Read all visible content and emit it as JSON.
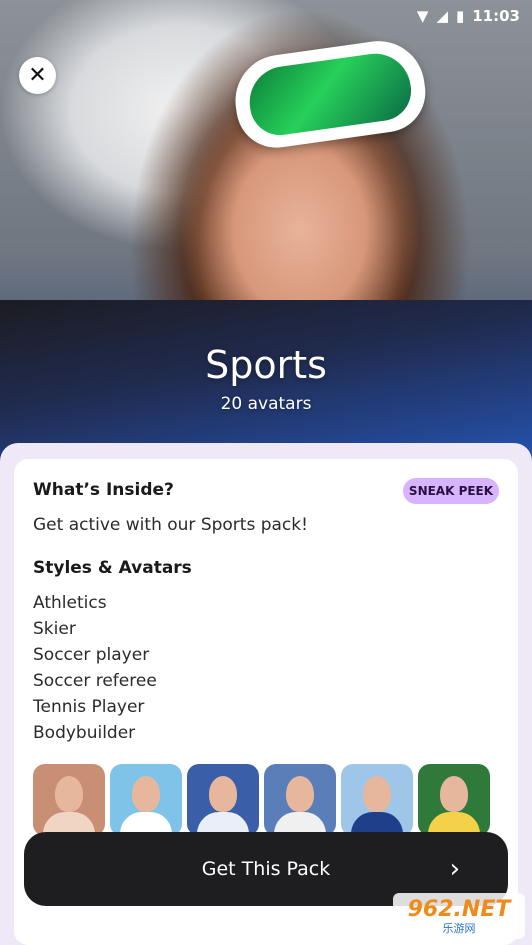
{
  "status_bar": {
    "wifi_icon": "wifi-icon",
    "signal_icon": "signal-icon",
    "battery_icon": "battery-charging-icon",
    "time": "11:03"
  },
  "hero": {
    "close_icon": "close-icon",
    "title": "Sports",
    "subtitle": "20 avatars"
  },
  "info": {
    "heading": "What’s Inside?",
    "badge": "SNEAK PEEK",
    "description": "Get active with our Sports pack!",
    "styles_heading": "Styles & Avatars",
    "styles": [
      "Athletics",
      "Skier",
      "Soccer player",
      "Soccer referee",
      "Tennis Player",
      "Bodybuilder"
    ]
  },
  "thumbnails": [
    {
      "name": "athletics-avatar",
      "bg": "#c98f74",
      "body": "#f0d4c4"
    },
    {
      "name": "tennis-avatar",
      "bg": "#7fc4e8",
      "body": "#ffffff"
    },
    {
      "name": "soccer-avatar",
      "bg": "#3a5fa8",
      "body": "#e9eef8"
    },
    {
      "name": "referee-avatar",
      "bg": "#5a7fb8",
      "body": "#f0f0f0"
    },
    {
      "name": "skier-avatar",
      "bg": "#9ec6e8",
      "body": "#1e3f8a"
    },
    {
      "name": "stadium-avatar",
      "bg": "#2f7a3a",
      "body": "#f3d24a"
    }
  ],
  "cta": {
    "label": "Get This Pack",
    "chevron_icon": "chevron-right-icon"
  },
  "watermark": {
    "top": "962.NET",
    "bottom": "乐游网"
  },
  "colors": {
    "badge_bg": "#d8b4fe",
    "cta_bg": "#1e1e20",
    "sheet_bg": "#efe8f6"
  }
}
